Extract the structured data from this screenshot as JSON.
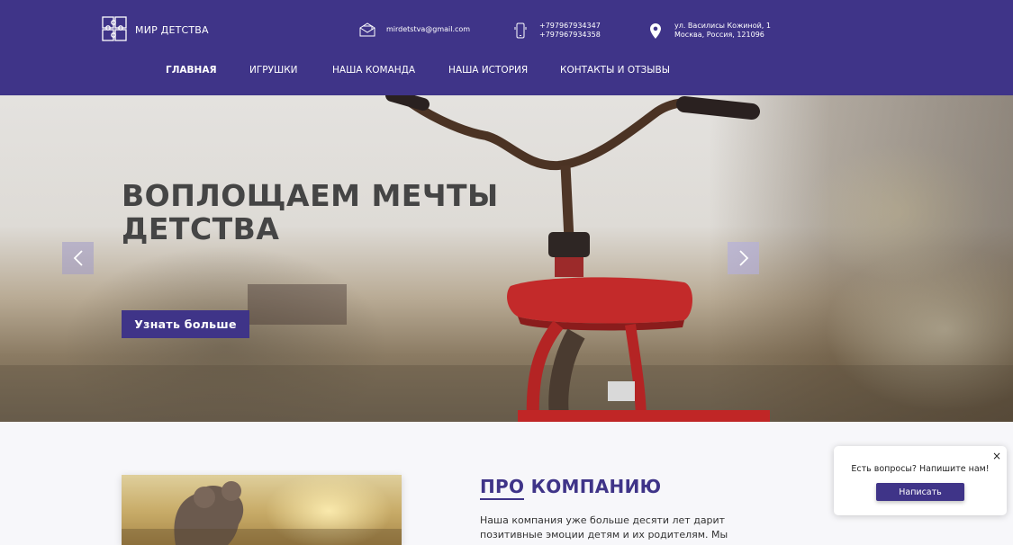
{
  "brand": {
    "name": "МИР ДЕТСТВА",
    "logo_icon": "puzzle-logo-icon"
  },
  "contacts": {
    "email": "mirdetstva@gmail.com",
    "phone1": "+797967934347",
    "phone2": "+797967934358",
    "address_line1": "ул. Василисы Кожиной, 1",
    "address_line2": "Москва, Россия, 121096"
  },
  "nav": {
    "items": [
      {
        "label": "ГЛАВНАЯ",
        "active": true
      },
      {
        "label": "ИГРУШКИ"
      },
      {
        "label": "НАША КОМАНДА"
      },
      {
        "label": "НАША ИСТОРИЯ"
      },
      {
        "label": "КОНТАКТЫ И ОТЗЫВЫ"
      }
    ]
  },
  "hero": {
    "title_line1": "ВОПЛОЩАЕМ МЕЧТЫ",
    "title_line2": "ДЕТСТВА",
    "button": "Узнать больше"
  },
  "about": {
    "title_highlight": "ПРО",
    "title_rest": "КОМПАНИЮ",
    "text_line1": "Наша компания уже больше десяти лет дарит",
    "text_line2": "позитивные эмоции детям и их родителям. Мы"
  },
  "chat": {
    "text": "Есть вопросы? Напишите нам!",
    "button": "Написать",
    "close": "×"
  },
  "colors": {
    "brand": "#3f3488",
    "hero_title": "#454545",
    "bike_red": "#c32a2a"
  }
}
